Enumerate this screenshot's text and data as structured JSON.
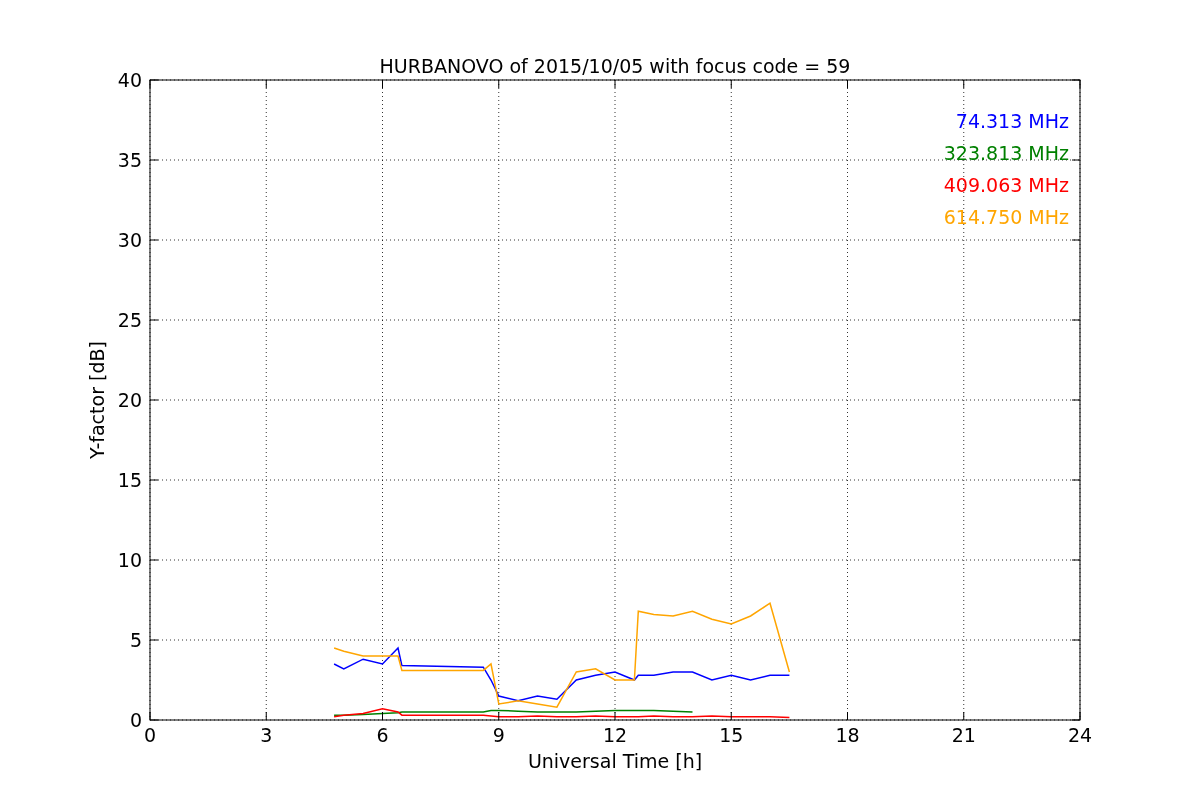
{
  "figure": {
    "chart_data": {
      "type": "line",
      "title": "HURBANOVO of 2015/10/05 with focus code = 59",
      "xlabel": "Universal Time [h]",
      "ylabel": "Y-factor [dB]",
      "x": [
        4.75,
        5,
        5.5,
        6,
        6.4,
        6.5,
        8.6,
        8.8,
        9,
        9.5,
        10,
        10.5,
        11,
        11.5,
        12,
        12.5,
        12.6,
        13,
        13.5,
        14,
        14.5,
        15,
        15.5,
        16,
        16.5
      ],
      "series": [
        {
          "name": "74.313 MHz",
          "color": "#0000ff",
          "values": [
            3.5,
            3.2,
            3.8,
            3.5,
            4.5,
            3.4,
            3.3,
            2.5,
            1.5,
            1.2,
            1.5,
            1.3,
            2.5,
            2.8,
            3,
            2.5,
            2.8,
            2.8,
            3,
            3,
            2.5,
            2.8,
            2.5,
            2.8,
            2.8
          ]
        },
        {
          "name": "323.813 MHz",
          "color": "#008000",
          "values": [
            0.3,
            0.3,
            0.35,
            0.4,
            0.45,
            0.5,
            0.5,
            0.6,
            0.6,
            0.55,
            0.5,
            0.5,
            0.5,
            0.55,
            0.6,
            0.6,
            0.6,
            0.6,
            0.55,
            0.5,
            null,
            null,
            null,
            null,
            null
          ]
        },
        {
          "name": "409.063 MHz",
          "color": "#ff0000",
          "values": [
            0.2,
            0.3,
            0.4,
            0.7,
            0.5,
            0.3,
            0.3,
            0.25,
            0.2,
            0.2,
            0.25,
            0.2,
            0.2,
            0.25,
            0.2,
            0.2,
            0.2,
            0.25,
            0.2,
            0.2,
            0.25,
            0.2,
            0.2,
            0.2,
            0.15
          ]
        },
        {
          "name": "614.750 MHz",
          "color": "#ffa500",
          "values": [
            4.5,
            4.3,
            4,
            4,
            4,
            3.1,
            3.1,
            3.5,
            1,
            1.2,
            1,
            0.8,
            3,
            3.2,
            2.5,
            2.5,
            6.8,
            6.6,
            6.5,
            6.8,
            6.3,
            6,
            6.5,
            7.3,
            3
          ]
        }
      ],
      "grid": true,
      "xlim": [
        0,
        24
      ],
      "ylim": [
        0,
        40
      ],
      "xticks": [
        0,
        3,
        6,
        9,
        12,
        15,
        18,
        21,
        24
      ],
      "yticks": [
        0,
        5,
        10,
        15,
        20,
        25,
        30,
        35,
        40
      ]
    }
  }
}
